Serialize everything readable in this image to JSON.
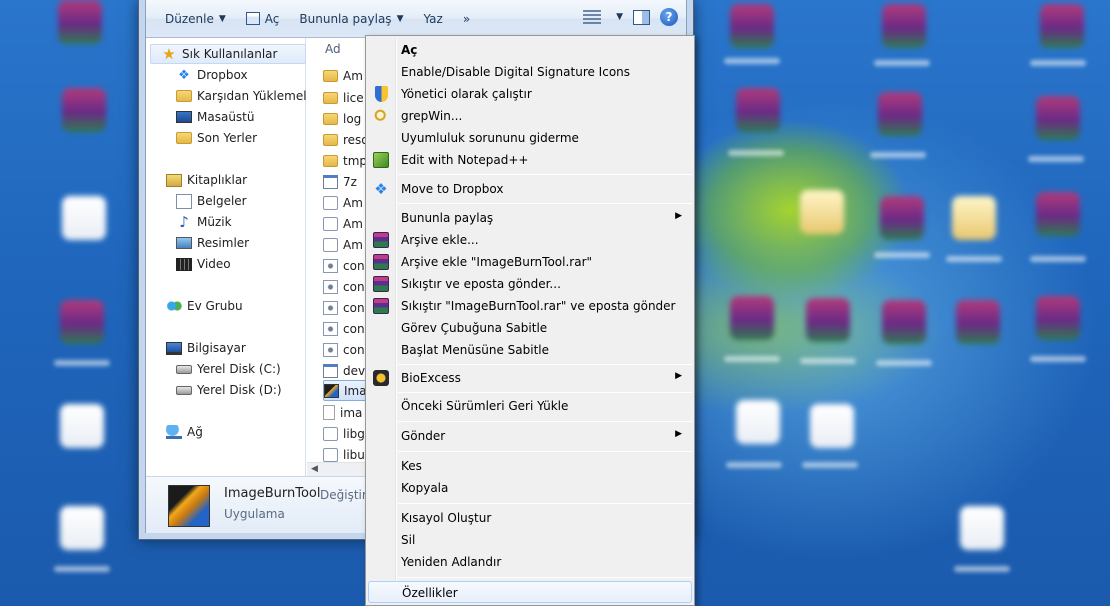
{
  "window": {
    "toolbar": {
      "organize": "Düzenle",
      "open": "Aç",
      "share": "Bununla paylaş",
      "burn": "Yaz",
      "more": "»"
    },
    "nav": {
      "favorites": "Sık Kullanılanlar",
      "dropbox": "Dropbox",
      "downloads": "Karşıdan Yüklemeler",
      "desktop": "Masaüstü",
      "recent": "Son Yerler",
      "libraries": "Kitaplıklar",
      "documents": "Belgeler",
      "music": "Müzik",
      "pictures": "Resimler",
      "video": "Video",
      "homegroup": "Ev Grubu",
      "computer": "Bilgisayar",
      "drive_c": "Yerel Disk (C:)",
      "drive_d": "Yerel Disk (D:)",
      "network": "Ağ"
    },
    "filelist": {
      "column_name": "Ad",
      "rows": [
        "Am",
        "lice",
        "log",
        "reso",
        "tmp",
        "7z",
        "Am",
        "Am",
        "Am",
        "con",
        "con",
        "con",
        "con",
        "con",
        "dev",
        "Imag",
        "ima",
        "libg",
        "libu"
      ]
    },
    "details": {
      "name": "ImageBurnTool",
      "modified": "Değiştirm",
      "type": "Uygulama"
    }
  },
  "context_menu": {
    "items": [
      {
        "label": "Aç",
        "icon": "none",
        "bold": true
      },
      {
        "label": "Enable/Disable Digital Signature Icons",
        "icon": "none"
      },
      {
        "label": "Yönetici olarak çalıştır",
        "icon": "uac-shield-icon"
      },
      {
        "label": "grepWin...",
        "icon": "grepwin-icon"
      },
      {
        "label": "Uyumluluk sorununu giderme",
        "icon": "none"
      },
      {
        "label": "Edit with Notepad++",
        "icon": "notepadpp-icon"
      },
      {
        "label": "Move to Dropbox",
        "icon": "dropbox-icon"
      },
      {
        "label": "Bununla paylaş",
        "icon": "none",
        "submenu": true
      },
      {
        "label": "Arşive ekle...",
        "icon": "winrar-icon"
      },
      {
        "label": "Arşive ekle \"ImageBurnTool.rar\"",
        "icon": "winrar-icon"
      },
      {
        "label": "Sıkıştır ve eposta gönder...",
        "icon": "winrar-icon"
      },
      {
        "label": "Sıkıştır \"ImageBurnTool.rar\" ve eposta gönder",
        "icon": "winrar-icon"
      },
      {
        "label": "Görev Çubuğuna Sabitle",
        "icon": "none"
      },
      {
        "label": "Başlat Menüsüne Sabitle",
        "icon": "none"
      },
      {
        "label": "BioExcess",
        "icon": "bioexcess-icon",
        "submenu": true
      },
      {
        "label": "Önceki Sürümleri Geri Yükle",
        "icon": "none"
      },
      {
        "label": "Gönder",
        "icon": "none",
        "submenu": true
      },
      {
        "label": "Kes",
        "icon": "none"
      },
      {
        "label": "Kopyala",
        "icon": "none"
      },
      {
        "label": "Kısayol Oluştur",
        "icon": "none"
      },
      {
        "label": "Sil",
        "icon": "none"
      },
      {
        "label": "Yeniden Adlandır",
        "icon": "none"
      },
      {
        "label": "Özellikler",
        "icon": "none",
        "highlighted": true
      }
    ],
    "submenu_arrow": "▶"
  }
}
